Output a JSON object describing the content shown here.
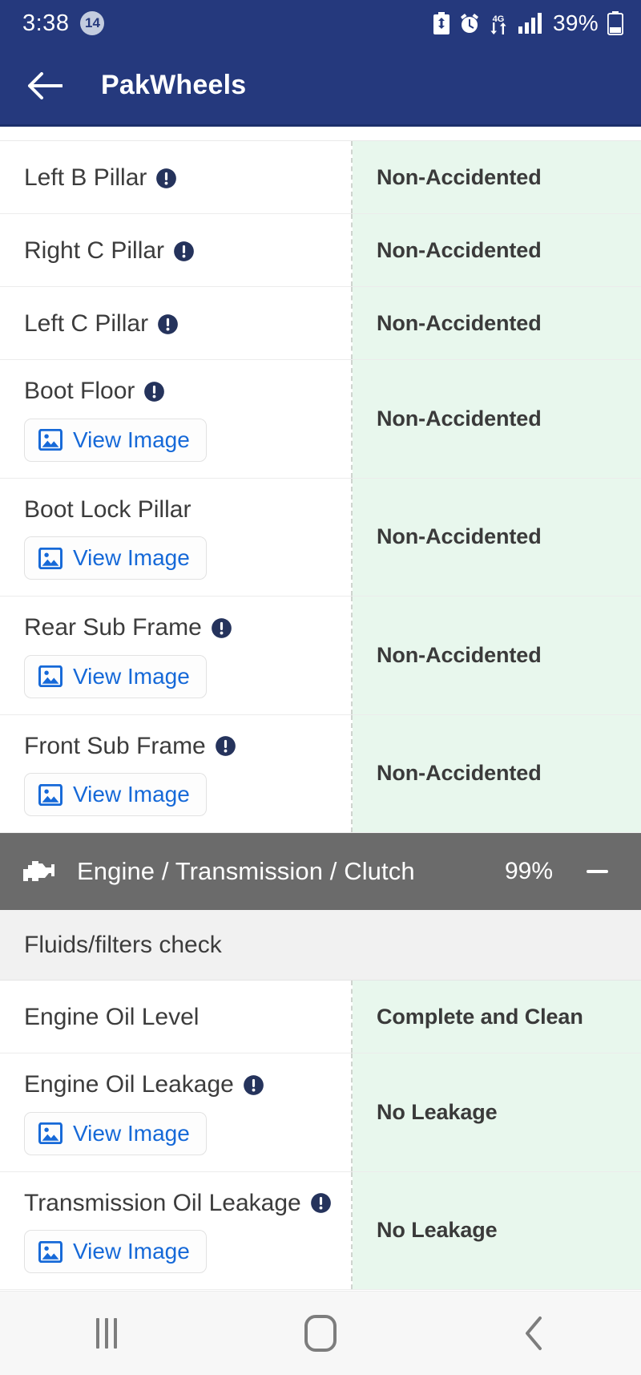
{
  "status_bar": {
    "time": "3:38",
    "notification_count": "14",
    "battery_percent": "39%",
    "icons": [
      "battery-saver-icon",
      "alarm-icon",
      "data-transfer-4g-icon",
      "signal-bars-icon",
      "battery-icon"
    ]
  },
  "app_bar": {
    "back_icon": "back-arrow-icon",
    "title": "PakWheels"
  },
  "colors": {
    "header_blue": "#25397d",
    "status_green_bg": "#e8f7ed",
    "section_gray": "#6b6b6b",
    "link_blue": "#1669d8",
    "info_icon_navy": "#25335c"
  },
  "view_image_label": "View Image",
  "rows": [
    {
      "name": "Left B Pillar",
      "info": true,
      "image_button": false,
      "status": "Non-Accidented"
    },
    {
      "name": "Right C Pillar",
      "info": true,
      "image_button": false,
      "status": "Non-Accidented"
    },
    {
      "name": "Left C Pillar",
      "info": true,
      "image_button": false,
      "status": "Non-Accidented"
    },
    {
      "name": "Boot Floor",
      "info": true,
      "image_button": true,
      "status": "Non-Accidented"
    },
    {
      "name": "Boot Lock Pillar",
      "info": false,
      "image_button": true,
      "status": "Non-Accidented"
    },
    {
      "name": "Rear Sub Frame",
      "info": true,
      "image_button": true,
      "status": "Non-Accidented"
    },
    {
      "name": "Front Sub Frame",
      "info": true,
      "image_button": true,
      "status": "Non-Accidented"
    }
  ],
  "section": {
    "icon": "engine-icon",
    "title": "Engine / Transmission / Clutch",
    "percent": "99%",
    "collapse_icon": "minus-icon"
  },
  "subsection": {
    "title": "Fluids/filters check"
  },
  "rows2": [
    {
      "name": "Engine Oil Level",
      "info": false,
      "image_button": false,
      "status": "Complete and Clean"
    },
    {
      "name": "Engine Oil Leakage",
      "info": true,
      "image_button": true,
      "status": "No Leakage"
    },
    {
      "name": "Transmission Oil Leakage",
      "info": true,
      "image_button": true,
      "status": "No Leakage"
    }
  ],
  "nav_bar": {
    "recents_label": "recents-icon",
    "home_label": "home-icon",
    "back_label": "back-icon"
  }
}
